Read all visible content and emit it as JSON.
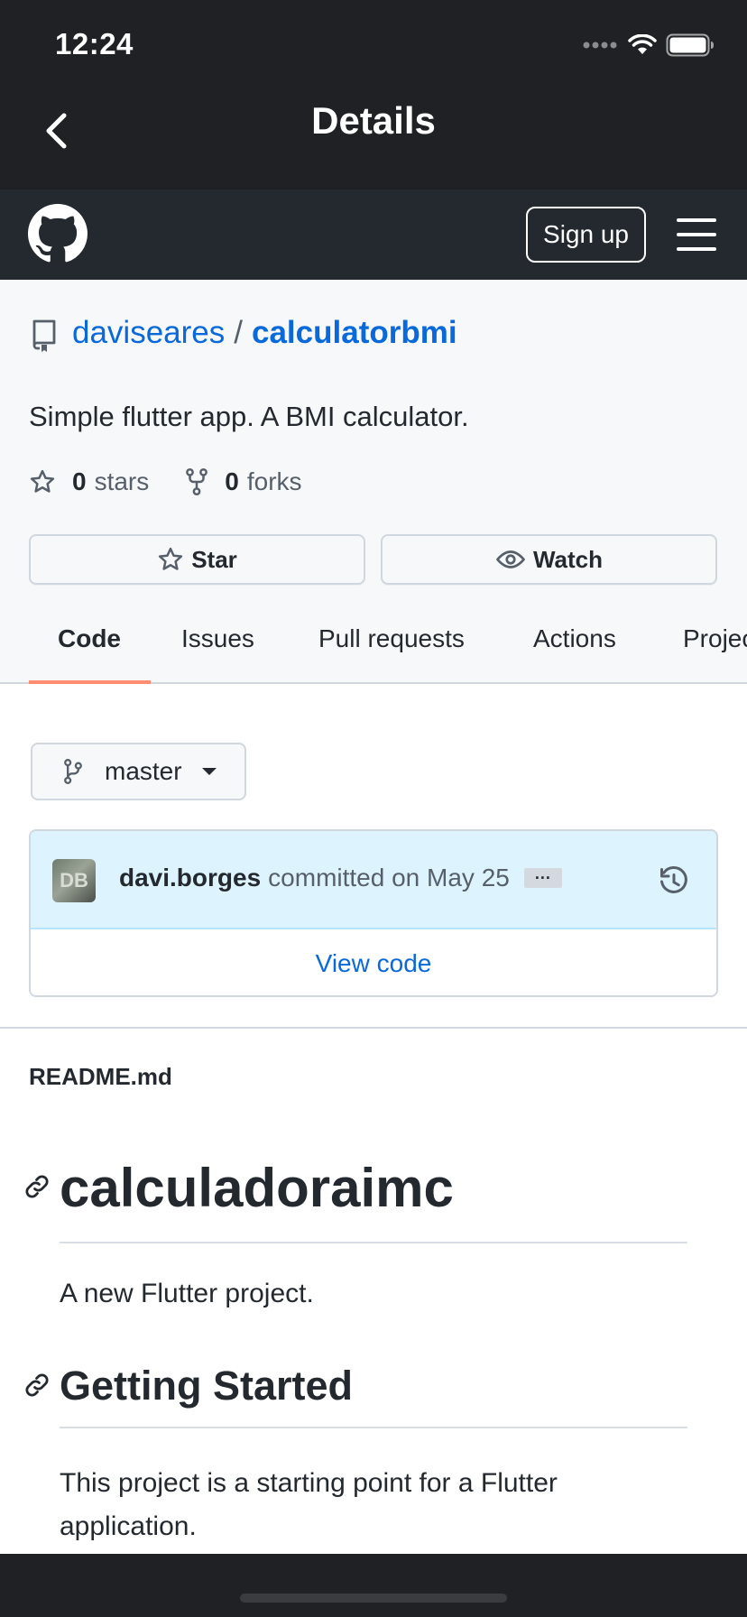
{
  "status_bar": {
    "time": "12:24"
  },
  "nav": {
    "title": "Details",
    "back_icon": "chevron-left-icon"
  },
  "github_header": {
    "logo": "github-octocat-icon",
    "signup_label": "Sign up",
    "menu_icon": "hamburger-menu-icon"
  },
  "repo": {
    "owner": "daviseares",
    "separator": "/",
    "name": "calculatorbmi",
    "description": "Simple flutter app. A BMI calculator.",
    "stars_count": "0",
    "stars_label": "stars",
    "forks_count": "0",
    "forks_label": "forks",
    "star_button": "Star",
    "watch_button": "Watch"
  },
  "tabs": [
    {
      "label": "Code",
      "active": true
    },
    {
      "label": "Issues",
      "active": false
    },
    {
      "label": "Pull requests",
      "active": false
    },
    {
      "label": "Actions",
      "active": false
    },
    {
      "label": "Projects",
      "active": false
    }
  ],
  "branch": {
    "name": "master"
  },
  "commit": {
    "author": "davi.borges",
    "message": "committed on May 25",
    "ellipsis": "···",
    "avatar_initials": "DB",
    "view_code_label": "View code"
  },
  "readme": {
    "filename": "README.md",
    "h1": "calculadoraimc",
    "p1": "A new Flutter project.",
    "h2": "Getting Started",
    "p2": "This project is a starting point for a Flutter application."
  },
  "colors": {
    "nav_bg": "#1f2125",
    "header_bg": "#24292f",
    "link": "#0969da",
    "tab_underline": "#fd8c73",
    "commit_bg": "#ddf4ff"
  }
}
